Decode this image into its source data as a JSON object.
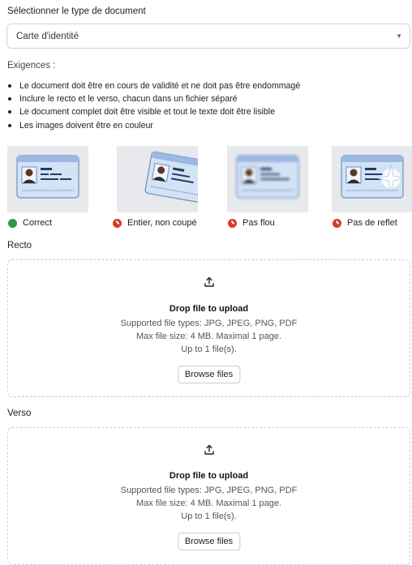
{
  "doc_type": {
    "label": "Sélectionner le type de document",
    "selected": "Carte d'identité"
  },
  "requirements": {
    "title": "Exigences :",
    "items": [
      "Le document doit être en cours de validité et ne doit pas être endommagé",
      "Inclure le recto et le verso, chacun dans un fichier séparé",
      "Le document complet doit être visible et tout le texte doit être lisible",
      "Les images doivent être en couleur"
    ]
  },
  "examples": [
    {
      "caption": "Correct",
      "status": "ok"
    },
    {
      "caption": "Entier, non coupé",
      "status": "bad"
    },
    {
      "caption": "Pas flou",
      "status": "bad"
    },
    {
      "caption": "Pas de reflet",
      "status": "bad"
    }
  ],
  "colors": {
    "ok": "#2e9a48",
    "bad": "#d93a2b",
    "card": "#cfe0f4",
    "card_accent": "#5f8fd0"
  },
  "recto": {
    "label": "Recto",
    "title": "Drop file to upload",
    "types": "Supported file types: JPG, JPEG, PNG, PDF",
    "size": "Max file size: 4 MB. Maximal 1 page.",
    "count": "Up to 1 file(s).",
    "button": "Browse files"
  },
  "verso": {
    "label": "Verso",
    "title": "Drop file to upload",
    "types": "Supported file types: JPG, JPEG, PNG, PDF",
    "size": "Max file size: 4 MB. Maximal 1 page.",
    "count": "Up to 1 file(s).",
    "button": "Browse files"
  }
}
